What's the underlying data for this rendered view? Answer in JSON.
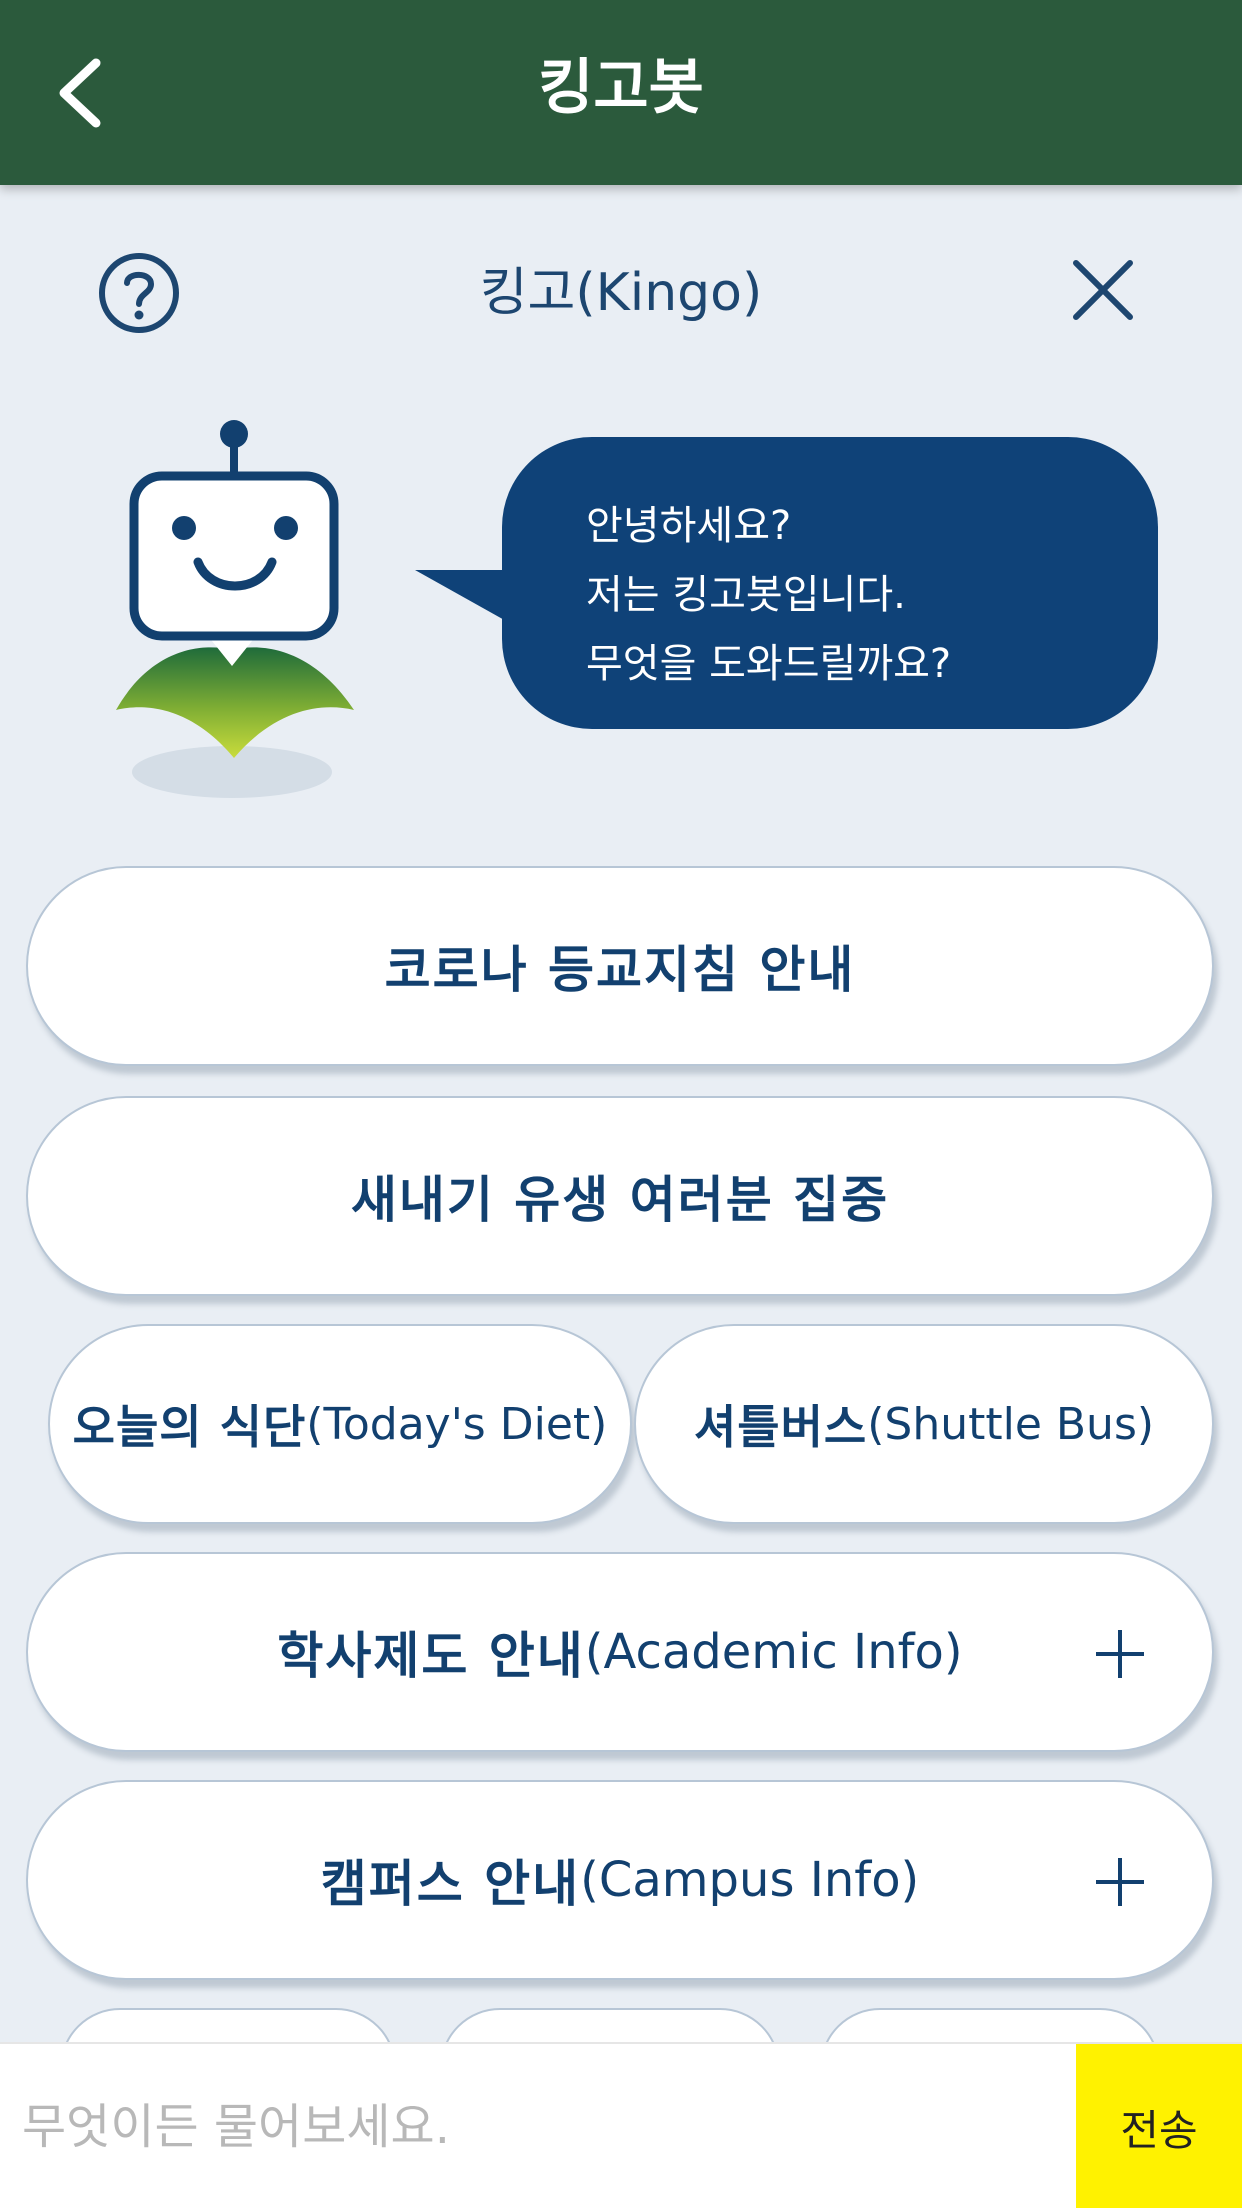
{
  "header": {
    "title": "킹고봇",
    "back_icon": "chevron-left-icon"
  },
  "subheader": {
    "title": "킹고(Kingo)",
    "help_icon": "question-circle-icon",
    "close_icon": "close-icon"
  },
  "chat": {
    "greeting_lines": [
      "안녕하세요?",
      "저는 킹고봇입니다.",
      "무엇을 도와드릴까요?"
    ]
  },
  "menu": {
    "corona": {
      "label": "코로나 등교지침 안내"
    },
    "freshmen": {
      "label": "새내기 유생 여러분 집중"
    },
    "diet": {
      "label_ko": "오늘의 식단",
      "label_en": "(Today's Diet)"
    },
    "shuttle": {
      "label_ko": "셔틀버스",
      "label_en": "(Shuttle Bus)"
    },
    "academic": {
      "label_ko": "학사제도 안내",
      "label_en": "(Academic Info)",
      "expand_icon": "plus-icon"
    },
    "campus": {
      "label_ko": "캠퍼스 안내",
      "label_en": "(Campus Info)",
      "expand_icon": "plus-icon"
    }
  },
  "input": {
    "placeholder": "무엇이든 물어보세요.",
    "value": "",
    "send_label": "전송"
  },
  "colors": {
    "header_bg": "#2b5a3c",
    "accent_blue": "#0f4278",
    "page_bg": "#e9eef4",
    "send_bg": "#fff200"
  }
}
